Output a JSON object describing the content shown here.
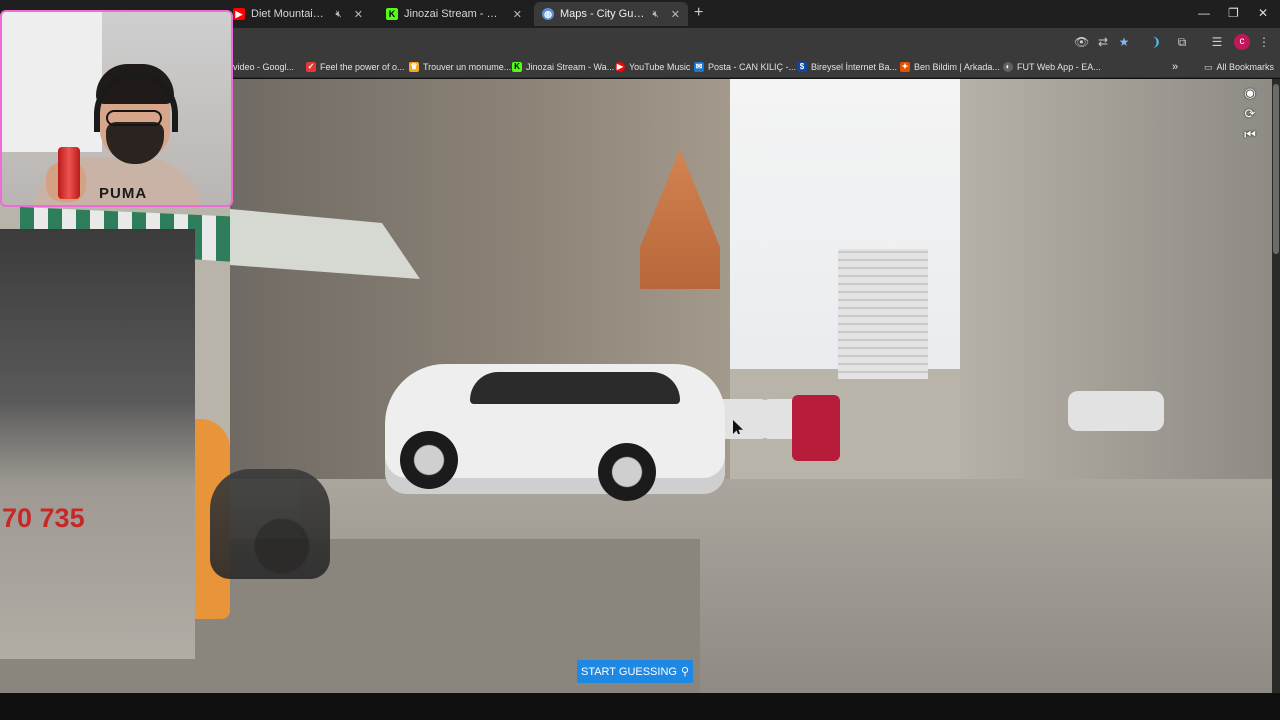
{
  "browser": {
    "tabs": [
      {
        "title": "Diet Mountain Dew | YouTu",
        "favicon": "youtube-icon",
        "muted": true
      },
      {
        "title": "Jinozai Stream - Kick Dashboard",
        "favicon": "kick-icon"
      },
      {
        "title": "Maps - City Guesser",
        "favicon": "globe-icon",
        "active": true,
        "muted": true
      }
    ],
    "bookmarks": [
      {
        "label": "z video - Googl...",
        "icon": "google-icon"
      },
      {
        "label": "Feel the power of o...",
        "icon": "check-icon",
        "color": "#e53935"
      },
      {
        "label": "Trouver un monume...",
        "icon": "crown-icon",
        "color": "#f9a825"
      },
      {
        "label": "Jinozai Stream - Wa...",
        "icon": "kick-icon",
        "color": "#53fc18"
      },
      {
        "label": "YouTube Music",
        "icon": "youtube-music-icon",
        "color": "#ff0000"
      },
      {
        "label": "Posta - CAN KILIÇ -...",
        "icon": "mail-icon",
        "color": "#1976d2"
      },
      {
        "label": "Bireysel İnternet Ba...",
        "icon": "dollar-icon",
        "color": "#0d47a1"
      },
      {
        "label": "Ben Bildim | Arkada...",
        "icon": "bulb-icon",
        "color": "#e65100"
      },
      {
        "label": "FUT Web App - EA...",
        "icon": "ea-icon",
        "color": "#616161"
      }
    ],
    "all_bookmarks_label": "All Bookmarks",
    "profile_initial": "c"
  },
  "street_view": {
    "storefront_number": "70 735"
  },
  "webcam": {
    "hoodie_brand": "PUMA"
  },
  "game": {
    "start_button_label": "START GUESSING"
  },
  "colors": {
    "accent": "#1e88e5",
    "webcam_border": "#f06ad8"
  }
}
